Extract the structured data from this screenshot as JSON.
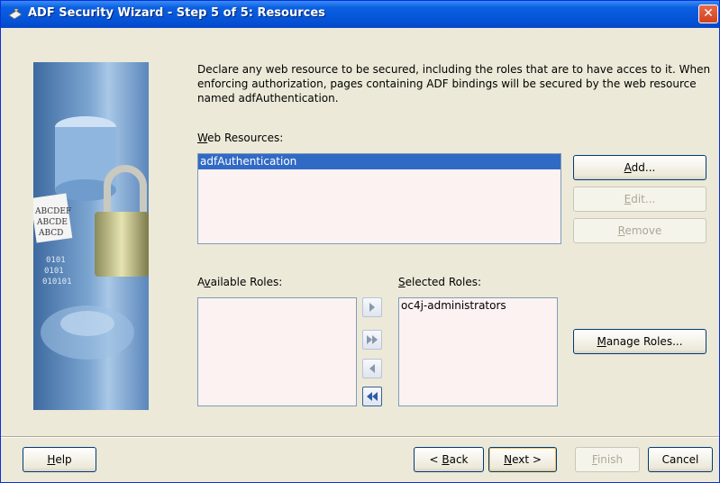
{
  "window": {
    "title": "ADF Security Wizard - Step 5 of 5: Resources",
    "close_symbol": "✕"
  },
  "description": "Declare any web resource to be secured, including the roles that are to have acces to it. When enforcing authorization, pages containing ADF bindings will be secured by the web resource named adfAuthentication.",
  "web_resources": {
    "label_mnemonic": "W",
    "label_rest": "eb Resources:",
    "items": [
      "adfAuthentication"
    ],
    "selected": "adfAuthentication"
  },
  "resource_buttons": {
    "add_mnemonic": "A",
    "add_rest": "dd...",
    "edit_mnemonic": "E",
    "edit_rest": "dit...",
    "remove_mnemonic": "R",
    "remove_rest": "emove"
  },
  "available_roles": {
    "label_pre": "A",
    "label_mnemonic": "v",
    "label_rest": "ailable Roles:",
    "items": []
  },
  "selected_roles": {
    "label_mnemonic": "S",
    "label_rest": "elected Roles:",
    "items": [
      "oc4j-administrators"
    ]
  },
  "move_buttons": {
    "move_right": "move-right-icon",
    "move_all_right": "move-all-right-icon",
    "move_left": "move-left-icon",
    "move_all_left": "move-all-left-icon"
  },
  "manage_roles": {
    "mnemonic": "M",
    "rest": "anage Roles..."
  },
  "footer": {
    "help_mnemonic": "H",
    "help_rest": "elp",
    "back_pre": "< ",
    "back_mnemonic": "B",
    "back_rest": "ack",
    "next_mnemonic": "N",
    "next_rest": "ext >",
    "finish_mnemonic": "F",
    "finish_rest": "inish",
    "cancel": "Cancel"
  },
  "colors": {
    "titlebar": "#0554d8",
    "selection": "#316ac5",
    "listbox_bg": "#fdf2f2",
    "dialog_bg": "#ece9d8"
  }
}
